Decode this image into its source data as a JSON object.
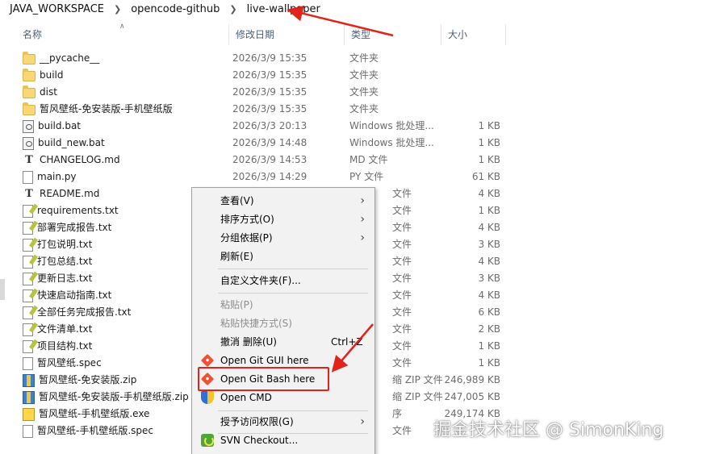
{
  "breadcrumb": [
    "JAVA_WORKSPACE",
    "opencode-github",
    "live-wallpaper"
  ],
  "columns": {
    "name": "名称",
    "modified": "修改日期",
    "type": "类型",
    "size": "大小"
  },
  "files": [
    {
      "name": "__pycache__",
      "date": "2026/3/9 15:35",
      "type": "文件夹",
      "size": "",
      "icon": "folder-icon"
    },
    {
      "name": "build",
      "date": "2026/3/9 15:35",
      "type": "文件夹",
      "size": "",
      "icon": "folder-icon"
    },
    {
      "name": "dist",
      "date": "2026/3/9 15:35",
      "type": "文件夹",
      "size": "",
      "icon": "folder-icon"
    },
    {
      "name": "暂风壁纸-免安装版-手机壁纸版",
      "date": "2026/3/9 15:35",
      "type": "文件夹",
      "size": "",
      "icon": "folder-icon"
    },
    {
      "name": "build.bat",
      "date": "2026/3/3 20:13",
      "type": "Windows 批处理...",
      "size": "1 KB",
      "icon": "batch-file-icon"
    },
    {
      "name": "build_new.bat",
      "date": "2026/3/9 14:48",
      "type": "Windows 批处理...",
      "size": "1 KB",
      "icon": "batch-file-icon"
    },
    {
      "name": "CHANGELOG.md",
      "date": "2026/3/9 14:53",
      "type": "MD 文件",
      "size": "1 KB",
      "icon": "markdown-file-icon"
    },
    {
      "name": "main.py",
      "date": "2026/3/9 14:29",
      "type": "PY 文件",
      "size": "61 KB",
      "icon": "generic-file-icon"
    },
    {
      "name": "README.md",
      "date": "",
      "type": "文件",
      "size": "4 KB",
      "icon": "markdown-file-icon"
    },
    {
      "name": "requirements.txt",
      "date": "",
      "type": "文件",
      "size": "1 KB",
      "icon": "text-file-icon"
    },
    {
      "name": "部署完成报告.txt",
      "date": "",
      "type": "文件",
      "size": "4 KB",
      "icon": "text-file-icon"
    },
    {
      "name": "打包说明.txt",
      "date": "",
      "type": "文件",
      "size": "3 KB",
      "icon": "text-file-icon"
    },
    {
      "name": "打包总结.txt",
      "date": "",
      "type": "文件",
      "size": "4 KB",
      "icon": "text-file-icon"
    },
    {
      "name": "更新日志.txt",
      "date": "",
      "type": "文件",
      "size": "3 KB",
      "icon": "text-file-icon"
    },
    {
      "name": "快速启动指南.txt",
      "date": "",
      "type": "文件",
      "size": "4 KB",
      "icon": "text-file-icon"
    },
    {
      "name": "全部任务完成报告.txt",
      "date": "",
      "type": "文件",
      "size": "6 KB",
      "icon": "text-file-icon"
    },
    {
      "name": "文件清单.txt",
      "date": "",
      "type": "文件",
      "size": "2 KB",
      "icon": "text-file-icon"
    },
    {
      "name": "项目结构.txt",
      "date": "",
      "type": "文件",
      "size": "1 KB",
      "icon": "text-file-icon"
    },
    {
      "name": "暂风壁纸.spec",
      "date": "",
      "type": "文件",
      "size": "1 KB",
      "icon": "generic-file-icon"
    },
    {
      "name": "暂风壁纸-免安装版.zip",
      "date": "",
      "type": "缩 ZIP 文件",
      "size": "246,989 KB",
      "icon": "zip-file-icon"
    },
    {
      "name": "暂风壁纸-免安装版-手机壁纸版.zip",
      "date": "",
      "type": "缩 ZIP 文件",
      "size": "247,005 KB",
      "icon": "zip-file-icon"
    },
    {
      "name": "暂风壁纸-手机壁纸版.exe",
      "date": "",
      "type": "序",
      "size": "249,174 KB",
      "icon": "exe-file-icon"
    },
    {
      "name": "暂风壁纸-手机壁纸版.spec",
      "date": "",
      "type": "文件",
      "size": "",
      "icon": "generic-file-icon"
    }
  ],
  "context_menu": {
    "view": "查看(V)",
    "sort_by": "排序方式(O)",
    "group_by": "分组依据(P)",
    "refresh": "刷新(E)",
    "customize_folder": "自定义文件夹(F)...",
    "paste": "粘贴(P)",
    "paste_shortcut": "粘贴快捷方式(S)",
    "undo_delete": "撤消 删除(U)",
    "undo_shortcut": "Ctrl+Z",
    "open_git_gui": "Open Git GUI here",
    "open_git_bash": "Open Git Bash here",
    "open_cmd": "Open CMD",
    "grant_access": "授予访问权限(G)",
    "svn_checkout": "SVN Checkout..."
  },
  "watermark": "掘金技术社区 @ SimonKing",
  "colors": {
    "annotation_red": "#e2231a",
    "menu_bg": "#f2f2f2",
    "header_text": "#4c607a"
  }
}
